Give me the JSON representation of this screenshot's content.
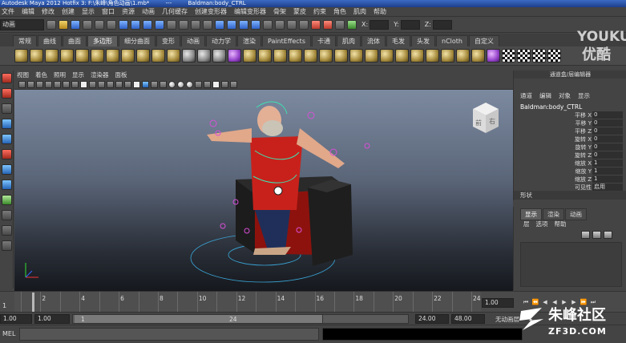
{
  "window": {
    "title_parts": [
      "Autodesk Maya 2012 Hotfix 3: F:\\朱峰\\角色动画\\1.mb*",
      "---",
      "Baldman:body_CTRL"
    ]
  },
  "menubar": {
    "items": [
      "文件",
      "编辑",
      "修改",
      "创建",
      "显示",
      "窗口",
      "资源",
      "动画",
      "几何缓存",
      "创建变形器",
      "编辑变形器",
      "骨架",
      "蒙皮",
      "约束",
      "角色",
      "肌肉",
      "帮助"
    ]
  },
  "statusline": {
    "mode": "动画",
    "coord_labels": [
      "X:",
      "Y:",
      "Z:"
    ]
  },
  "shelf": {
    "tabs": [
      "常规",
      "曲线",
      "曲面",
      "多边形",
      "细分曲面",
      "变形",
      "动画",
      "动力学",
      "渲染",
      "PaintEffects",
      "卡通",
      "肌肉",
      "流体",
      "毛发",
      "头发",
      "nCloth",
      "自定义"
    ],
    "active_tab": 3
  },
  "viewport": {
    "menu": [
      "视图",
      "着色",
      "照明",
      "显示",
      "渲染器",
      "面板"
    ],
    "viewcube_labels": [
      "前",
      "右"
    ]
  },
  "channel_box": {
    "title": "通道盒/层编辑器",
    "menu": [
      "通道",
      "编辑",
      "对象",
      "显示"
    ],
    "object_name": "Baldman:body_CTRL",
    "attributes": [
      {
        "name": "平移 X",
        "value": "0"
      },
      {
        "name": "平移 Y",
        "value": "0"
      },
      {
        "name": "平移 Z",
        "value": "0"
      },
      {
        "name": "旋转 X",
        "value": "0"
      },
      {
        "name": "旋转 Y",
        "value": "0"
      },
      {
        "name": "旋转 Z",
        "value": "0"
      },
      {
        "name": "缩放 X",
        "value": "1"
      },
      {
        "name": "缩放 Y",
        "value": "1"
      },
      {
        "name": "缩放 Z",
        "value": "1"
      },
      {
        "name": "可见性",
        "value": "启用"
      }
    ],
    "shapes_label": "形状"
  },
  "layer_editor": {
    "tabs": [
      "显示",
      "渲染",
      "动画"
    ],
    "menu": [
      "层",
      "选项",
      "帮助"
    ]
  },
  "timeline": {
    "current_frame": "1",
    "tick_labels": [
      "2",
      "4",
      "6",
      "8",
      "10",
      "12",
      "14",
      "16",
      "18",
      "20",
      "22",
      "24"
    ],
    "current_time_field": "1.00"
  },
  "range": {
    "start_time": "1.00",
    "start_playback": "1.00",
    "slider_start": "1",
    "slider_end": "24",
    "end_playback": "24.00",
    "end_time": "48.00",
    "anim_layer": "无动画层"
  },
  "command_line": {
    "label": "MEL"
  },
  "watermarks": {
    "youku_en": "YOUKU",
    "youku_cn": "优酷",
    "site_cn": "朱峰社区",
    "site_en": "ZF3D.COM"
  }
}
